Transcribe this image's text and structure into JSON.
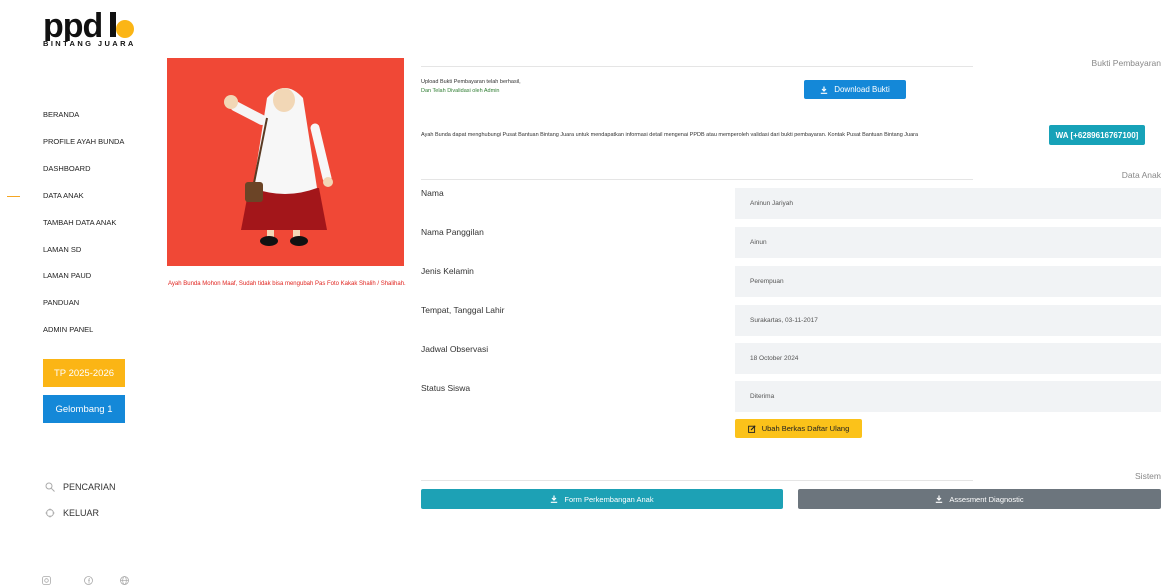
{
  "brand": {
    "logo_text": "ppdb",
    "subtitle": "BINTANG JUARA"
  },
  "nav": {
    "items": [
      {
        "label": "BERANDA"
      },
      {
        "label": "PROFILE AYAH BUNDA"
      },
      {
        "label": "DASHBOARD"
      },
      {
        "label": "DATA ANAK",
        "active": true
      },
      {
        "label": "TAMBAH DATA ANAK"
      },
      {
        "label": "LAMAN SD"
      },
      {
        "label": "LAMAN PAUD"
      },
      {
        "label": "PANDUAN"
      },
      {
        "label": "ADMIN PANEL"
      }
    ],
    "active_color": "#f5a623"
  },
  "badges": {
    "tp": "TP 2025-2026",
    "gelombang": "Gelombang 1"
  },
  "side_links": {
    "search": "PENCARIAN",
    "logout": "KELUAR"
  },
  "social_icons": [
    "instagram-icon",
    "facebook-icon",
    "globe-icon"
  ],
  "photo": {
    "warning": "Ayah Bunda Mohon Maaf, Sudah tidak bisa mengubah Pas Foto Kakak Shalih / Shalihah."
  },
  "payment": {
    "section_title": "Bukti Pembayaran",
    "upload_status": "Upload Bukti Pembayaran telah berhasil,",
    "validated_status": "Dan Telah Divalidasi oleh Admin",
    "download_label": "Download Bukti",
    "info": "Ayah Bunda dapat menghubungi Pusat Bantuan Bintang Juara untuk mendapatkan informasi detail mengenai PPDB atau memperoleh validasi dari bukti pembayaran. Kontak Pusat Bantuan Bintang Juara",
    "wa_label": "WA [+6289616767100]"
  },
  "child_data": {
    "section_title": "Data Anak",
    "fields": [
      {
        "label": "Nama",
        "value": "Aninun Jariyah"
      },
      {
        "label": "Nama Panggilan",
        "value": "Ainun"
      },
      {
        "label": "Jenis Kelamin",
        "value": "Perempuan"
      },
      {
        "label": "Tempat, Tanggal Lahir",
        "value": "Surakartas, 03-11-2017"
      },
      {
        "label": "Jadwal Observasi",
        "value": "18 October 2024"
      },
      {
        "label": "Status Siswa",
        "value": "Diterima"
      }
    ],
    "edit_button": "Ubah Berkas Daftar Ulang"
  },
  "system": {
    "section_title": "Sistem",
    "form_button": "Form Perkembangan Anak",
    "assessment_button": "Assesment Diagnostic"
  },
  "colors": {
    "primary_blue": "#1488d8",
    "teal": "#1da1b5",
    "yellow": "#fbc21a",
    "badge_yellow": "#fbb515",
    "gray": "#6c757d",
    "photo_bg": "#f04836",
    "warning_red": "#e0241f"
  }
}
